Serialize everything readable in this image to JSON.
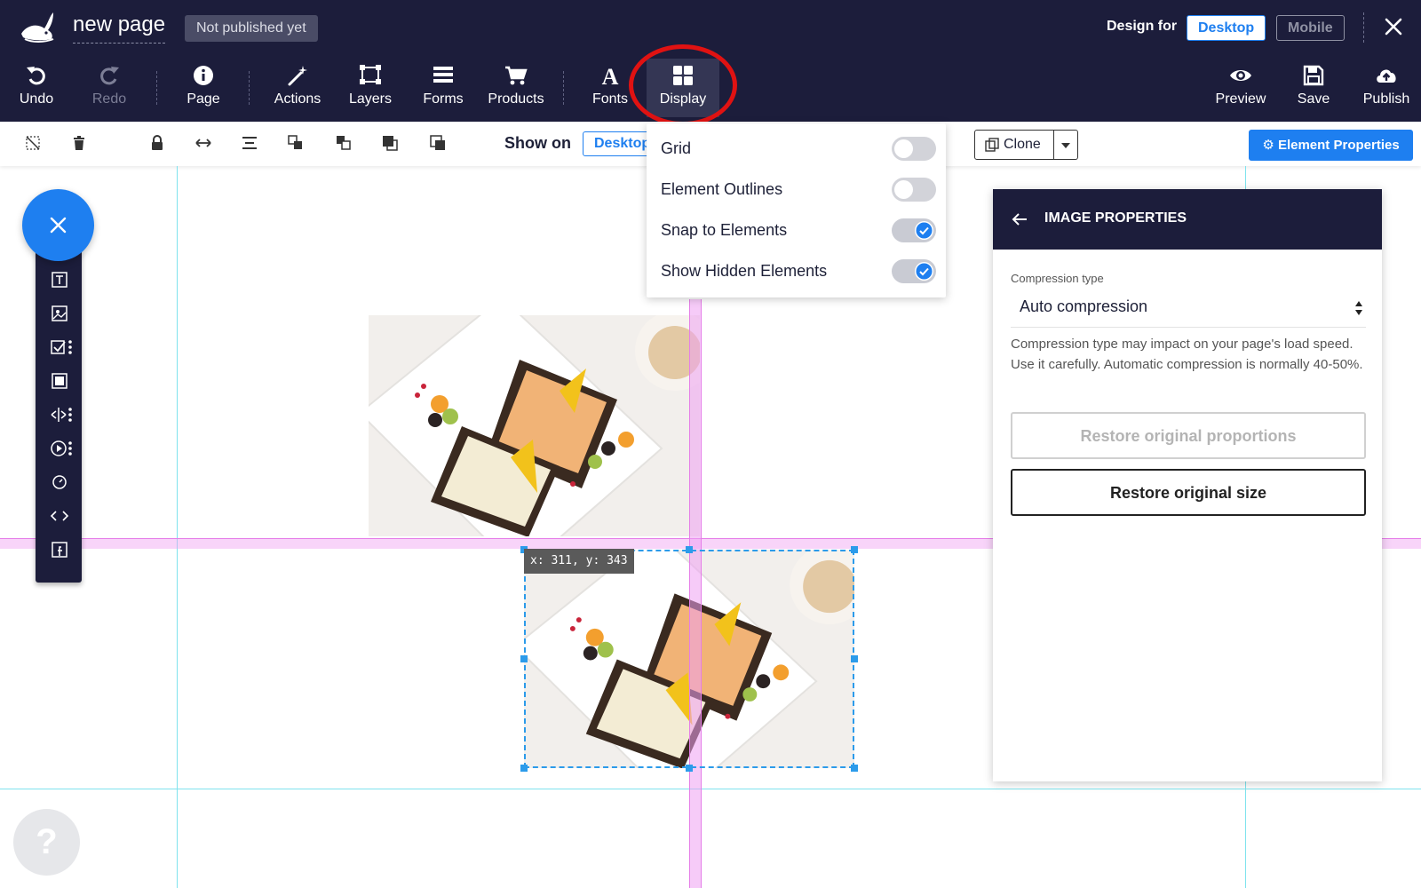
{
  "header": {
    "page_title": "new page",
    "publish_status": "Not published yet",
    "design_for_label": "Design for",
    "design_modes": [
      "Desktop",
      "Mobile"
    ],
    "active_design_mode": "Desktop"
  },
  "toolbar": {
    "undo": "Undo",
    "redo": "Redo",
    "page": "Page",
    "actions": "Actions",
    "layers": "Layers",
    "forms": "Forms",
    "products": "Products",
    "fonts": "Fonts",
    "display": "Display",
    "preview": "Preview",
    "save": "Save",
    "publish": "Publish"
  },
  "secondary_toolbar": {
    "show_on_label": "Show on",
    "show_on_value": "Desktop",
    "clone_label": "Clone",
    "element_properties_label": "Element Properties"
  },
  "display_menu": {
    "items": [
      {
        "label": "Grid",
        "enabled": false
      },
      {
        "label": "Element Outlines",
        "enabled": false
      },
      {
        "label": "Snap to Elements",
        "enabled": true
      },
      {
        "label": "Show Hidden Elements",
        "enabled": true
      }
    ]
  },
  "canvas": {
    "selection_coords": "x: 311, y: 343"
  },
  "properties_panel": {
    "title": "IMAGE PROPERTIES",
    "compression_label": "Compression type",
    "compression_value": "Auto compression",
    "compression_help": "Compression type may impact on your page's load speed. Use it carefully. Automatic compression is normally 40-50%.",
    "restore_proportions": "Restore original proportions",
    "restore_size": "Restore original size"
  },
  "help_label": "?",
  "colors": {
    "header_bg": "#1c1d3b",
    "accent": "#1e7ff0",
    "snap_guide": "#efa0f2",
    "layout_guide": "#7fe3ee",
    "highlight_ring": "#e01212"
  }
}
